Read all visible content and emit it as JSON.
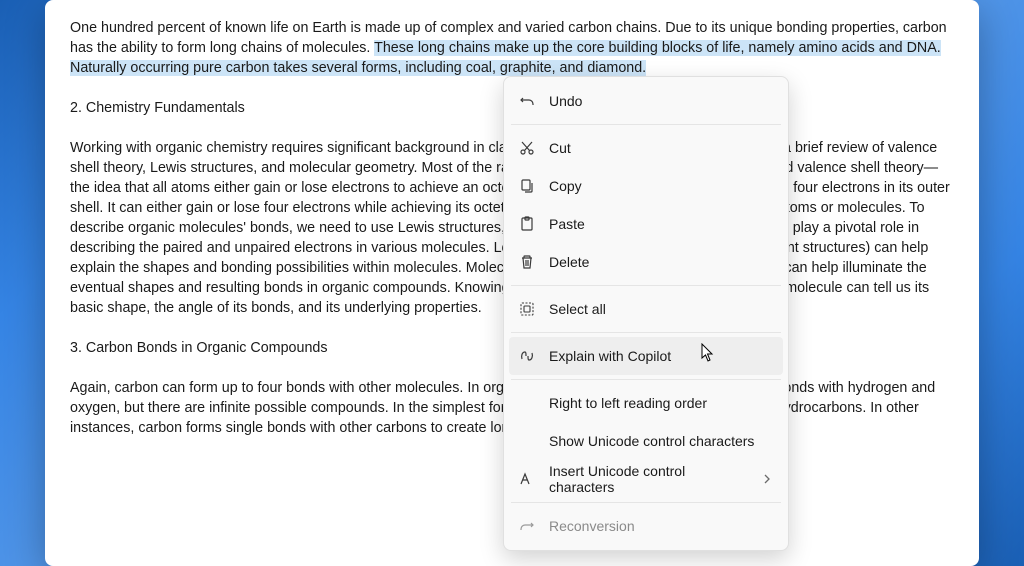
{
  "document": {
    "para1_before": "One hundred percent of known life on Earth is made up of complex and varied carbon chains. Due to its unique bonding properties, carbon has the ability to form long chains of molecules. ",
    "para1_selected": "These long chains make up the core building blocks of life, namely amino acids and DNA. Naturally occurring pure carbon takes several forms, including coal, graphite, and diamond.",
    "heading2": "2. Chemistry Fundamentals",
    "para2": "Working with organic chemistry requires significant background in classical chemistry. In this section, we provide a brief review of valence shell theory, Lewis structures, and molecular geometry. Most of the rationale for organic chemistry revolves around valence shell theory—the idea that all atoms either gain or lose electrons to achieve an octet. Carbon is unique in this respect due to the four electrons in its outer shell. It can either gain or lose four electrons while achieving its octet. This creates four atomic bonds with other atoms or molecules. To describe organic molecules' bonds, we need to use Lewis structures, or a Lewis dot diagram. Lewis dot structures play a pivotal role in describing the paired and unpaired electrons in various molecules. Lewis structures (along with examining resonant structures) can help explain the shapes and bonding possibilities within molecules. Molecular orbital theory and electron orbital shells can help illuminate the eventual shapes and resulting bonds in organic compounds. Knowing the geometry of the atoms that comprise a molecule can tell us its basic shape, the angle of its bonds, and its underlying properties.",
    "heading3": "3. Carbon Bonds in Organic Compounds",
    "para3": "Again, carbon can form up to four bonds with other molecules. In organic chemistry, we find that carbon usually bonds with hydrogen and oxygen, but there are infinite possible compounds. In the simplest forms, carbon bonds with hydrogen to create hydrocarbons. In other instances, carbon forms single bonds with other carbons to create longer chains."
  },
  "menu": {
    "undo": "Undo",
    "cut": "Cut",
    "copy": "Copy",
    "paste": "Paste",
    "delete": "Delete",
    "select_all": "Select all",
    "explain": "Explain with Copilot",
    "rtl": "Right to left reading order",
    "show_unicode": "Show Unicode control characters",
    "insert_unicode": "Insert Unicode control characters",
    "reconversion": "Reconversion"
  }
}
